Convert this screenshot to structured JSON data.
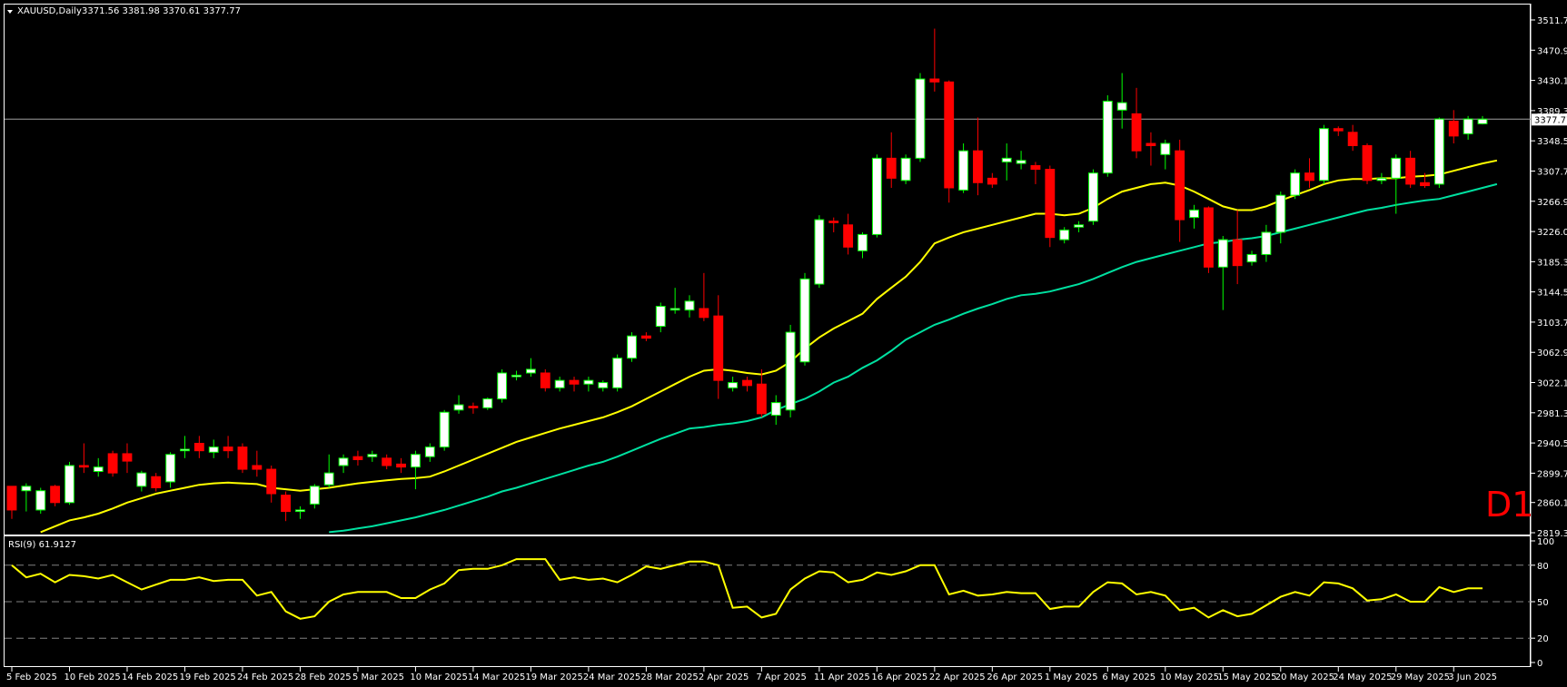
{
  "header": {
    "symbol_label": "XAUUSD,Daily",
    "ohlc_label": "3371.56 3381.98 3370.61 3377.77"
  },
  "timeframe_label": "D1",
  "current_price_label": "3377.77",
  "rsi": {
    "label": "RSI(9) 61.9127",
    "levels": [
      80,
      50,
      20
    ],
    "axis_labels": [
      "100",
      "80",
      "50",
      "20",
      "0"
    ]
  },
  "colors": {
    "background": "#000000",
    "bull_fill": "#ffffff",
    "bear_fill": "#ff0000",
    "wick_bull": "#00ff00",
    "wick_bear": "#ff0000",
    "ma_fast": "#ffff00",
    "ma_slow": "#00e0a0",
    "rsi_line": "#ffff00",
    "axis": "#ffffff",
    "grid": "#808080"
  },
  "chart_data": {
    "type": "candlestick",
    "title": "XAUUSD,Daily",
    "ylim": [
      2819.3,
      3511.7
    ],
    "y_ticks": [
      "3511.70",
      "3470.90",
      "3430.10",
      "3389.30",
      "3348.50",
      "3307.70",
      "3266.90",
      "3226.00",
      "3185.30",
      "3144.50",
      "3103.70",
      "3062.90",
      "3022.10",
      "2981.30",
      "2940.50",
      "2899.70",
      "2860.10",
      "2819.30"
    ],
    "x_labels": [
      "5 Feb 2025",
      "10 Feb 2025",
      "14 Feb 2025",
      "19 Feb 2025",
      "24 Feb 2025",
      "28 Feb 2025",
      "5 Mar 2025",
      "10 Mar 2025",
      "14 Mar 2025",
      "19 Mar 2025",
      "24 Mar 2025",
      "28 Mar 2025",
      "2 Apr 2025",
      "7 Apr 2025",
      "11 Apr 2025",
      "16 Apr 2025",
      "22 Apr 2025",
      "26 Apr 2025",
      "1 May 2025",
      "6 May 2025",
      "10 May 2025",
      "15 May 2025",
      "20 May 2025",
      "24 May 2025",
      "29 May 2025",
      "3 Jun 2025"
    ],
    "candles": [
      [
        2882,
        2850,
        2838,
        2882
      ],
      [
        2876,
        2882,
        2848,
        2886
      ],
      [
        2850,
        2876,
        2845,
        2880
      ],
      [
        2882,
        2860,
        2855,
        2884
      ],
      [
        2860,
        2910,
        2857,
        2915
      ],
      [
        2910,
        2908,
        2900,
        2940
      ],
      [
        2902,
        2908,
        2895,
        2920
      ],
      [
        2926,
        2900,
        2895,
        2930
      ],
      [
        2926,
        2916,
        2900,
        2940
      ],
      [
        2882,
        2900,
        2875,
        2903
      ],
      [
        2895,
        2880,
        2875,
        2900
      ],
      [
        2888,
        2925,
        2880,
        2928
      ],
      [
        2930,
        2932,
        2920,
        2950
      ],
      [
        2940,
        2930,
        2920,
        2950
      ],
      [
        2928,
        2935,
        2920,
        2945
      ],
      [
        2935,
        2930,
        2920,
        2950
      ],
      [
        2935,
        2905,
        2900,
        2940
      ],
      [
        2910,
        2905,
        2895,
        2930
      ],
      [
        2905,
        2872,
        2860,
        2910
      ],
      [
        2870,
        2848,
        2835,
        2875
      ],
      [
        2848,
        2850,
        2838,
        2855
      ],
      [
        2858,
        2882,
        2852,
        2885
      ],
      [
        2884,
        2900,
        2880,
        2925
      ],
      [
        2910,
        2920,
        2900,
        2925
      ],
      [
        2922,
        2918,
        2910,
        2930
      ],
      [
        2922,
        2925,
        2915,
        2930
      ],
      [
        2920,
        2910,
        2905,
        2925
      ],
      [
        2912,
        2908,
        2900,
        2920
      ],
      [
        2908,
        2925,
        2878,
        2930
      ],
      [
        2922,
        2935,
        2915,
        2940
      ],
      [
        2935,
        2982,
        2930,
        2985
      ],
      [
        2985,
        2992,
        2980,
        3005
      ],
      [
        2990,
        2988,
        2980,
        2995
      ],
      [
        2988,
        3000,
        2985,
        3002
      ],
      [
        3000,
        3035,
        2995,
        3040
      ],
      [
        3030,
        3032,
        3025,
        3038
      ],
      [
        3035,
        3040,
        3030,
        3055
      ],
      [
        3035,
        3015,
        3010,
        3040
      ],
      [
        3015,
        3025,
        3010,
        3030
      ],
      [
        3025,
        3020,
        3010,
        3030
      ],
      [
        3020,
        3025,
        3010,
        3030
      ],
      [
        3015,
        3022,
        3010,
        3025
      ],
      [
        3015,
        3055,
        3010,
        3060
      ],
      [
        3055,
        3085,
        3050,
        3090
      ],
      [
        3085,
        3082,
        3078,
        3090
      ],
      [
        3098,
        3125,
        3090,
        3130
      ],
      [
        3120,
        3122,
        3115,
        3150
      ],
      [
        3120,
        3132,
        3110,
        3140
      ],
      [
        3122,
        3110,
        3105,
        3170
      ],
      [
        3112,
        3025,
        3000,
        3140
      ],
      [
        3015,
        3022,
        3010,
        3030
      ],
      [
        3025,
        3018,
        3010,
        3030
      ],
      [
        3020,
        2980,
        2975,
        3040
      ],
      [
        2978,
        2995,
        2965,
        3005
      ],
      [
        2985,
        3090,
        2975,
        3100
      ],
      [
        3050,
        3162,
        3045,
        3170
      ],
      [
        3155,
        3242,
        3150,
        3248
      ],
      [
        3240,
        3238,
        3225,
        3245
      ],
      [
        3235,
        3205,
        3195,
        3250
      ],
      [
        3200,
        3222,
        3190,
        3225
      ],
      [
        3222,
        3325,
        3218,
        3330
      ],
      [
        3325,
        3298,
        3285,
        3360
      ],
      [
        3295,
        3325,
        3290,
        3330
      ],
      [
        3325,
        3432,
        3320,
        3440
      ],
      [
        3432,
        3428,
        3415,
        3500
      ],
      [
        3428,
        3285,
        3265,
        3430
      ],
      [
        3282,
        3335,
        3278,
        3345
      ],
      [
        3335,
        3292,
        3275,
        3380
      ],
      [
        3298,
        3290,
        3285,
        3305
      ],
      [
        3320,
        3325,
        3295,
        3345
      ],
      [
        3318,
        3322,
        3310,
        3335
      ],
      [
        3315,
        3310,
        3290,
        3320
      ],
      [
        3310,
        3218,
        3205,
        3315
      ],
      [
        3215,
        3228,
        3210,
        3232
      ],
      [
        3232,
        3235,
        3225,
        3240
      ],
      [
        3240,
        3305,
        3235,
        3310
      ],
      [
        3305,
        3402,
        3300,
        3410
      ],
      [
        3390,
        3400,
        3365,
        3440
      ],
      [
        3385,
        3335,
        3325,
        3420
      ],
      [
        3345,
        3342,
        3315,
        3360
      ],
      [
        3330,
        3345,
        3310,
        3350
      ],
      [
        3335,
        3242,
        3212,
        3350
      ],
      [
        3245,
        3255,
        3230,
        3262
      ],
      [
        3258,
        3178,
        3170,
        3260
      ],
      [
        3178,
        3215,
        3120,
        3220
      ],
      [
        3215,
        3180,
        3155,
        3255
      ],
      [
        3185,
        3195,
        3180,
        3200
      ],
      [
        3195,
        3225,
        3185,
        3235
      ],
      [
        3225,
        3275,
        3210,
        3280
      ],
      [
        3275,
        3305,
        3270,
        3310
      ],
      [
        3305,
        3295,
        3285,
        3325
      ],
      [
        3295,
        3365,
        3290,
        3370
      ],
      [
        3365,
        3362,
        3355,
        3368
      ],
      [
        3360,
        3342,
        3335,
        3370
      ],
      [
        3342,
        3295,
        3290,
        3345
      ],
      [
        3295,
        3298,
        3290,
        3305
      ],
      [
        3298,
        3325,
        3250,
        3330
      ],
      [
        3325,
        3290,
        3285,
        3335
      ],
      [
        3292,
        3288,
        3285,
        3305
      ],
      [
        3290,
        3378,
        3285,
        3380
      ],
      [
        3375,
        3355,
        3345,
        3390
      ],
      [
        3358,
        3378,
        3350,
        3382
      ],
      [
        3371.56,
        3377.77,
        3370.61,
        3381.98
      ]
    ],
    "ma_fast": [
      2805,
      2812,
      2820,
      2828,
      2836,
      2840,
      2845,
      2852,
      2860,
      2866,
      2872,
      2876,
      2880,
      2884,
      2886,
      2887,
      2886,
      2885,
      2880,
      2878,
      2876,
      2878,
      2880,
      2883,
      2886,
      2888,
      2890,
      2892,
      2893,
      2895,
      2902,
      2910,
      2918,
      2926,
      2934,
      2942,
      2948,
      2954,
      2960,
      2965,
      2970,
      2975,
      2982,
      2990,
      3000,
      3010,
      3020,
      3030,
      3038,
      3040,
      3038,
      3035,
      3033,
      3038,
      3050,
      3068,
      3083,
      3095,
      3105,
      3115,
      3135,
      3150,
      3165,
      3185,
      3210,
      3218,
      3225,
      3230,
      3235,
      3240,
      3245,
      3250,
      3250,
      3248,
      3250,
      3258,
      3270,
      3280,
      3285,
      3290,
      3292,
      3288,
      3280,
      3270,
      3260,
      3255,
      3255,
      3260,
      3268,
      3275,
      3282,
      3290,
      3295,
      3297,
      3297,
      3298,
      3298,
      3300,
      3301,
      3303,
      3308,
      3313,
      3318,
      3322
    ],
    "ma_slow": [
      2760,
      2763,
      2766,
      2769,
      2772,
      2775,
      2778,
      2781,
      2784,
      2787,
      2790,
      2793,
      2796,
      2799,
      2802,
      2805,
      2808,
      2810,
      2812,
      2814,
      2815,
      2818,
      2820,
      2822,
      2825,
      2828,
      2832,
      2836,
      2840,
      2845,
      2850,
      2856,
      2862,
      2868,
      2875,
      2880,
      2886,
      2892,
      2898,
      2904,
      2910,
      2915,
      2922,
      2930,
      2938,
      2946,
      2953,
      2960,
      2962,
      2965,
      2967,
      2970,
      2975,
      2985,
      2993,
      3000,
      3010,
      3022,
      3030,
      3042,
      3052,
      3065,
      3080,
      3090,
      3100,
      3107,
      3115,
      3122,
      3128,
      3135,
      3140,
      3142,
      3145,
      3150,
      3155,
      3162,
      3170,
      3178,
      3185,
      3190,
      3195,
      3200,
      3205,
      3210,
      3212,
      3215,
      3217,
      3220,
      3225,
      3230,
      3235,
      3240,
      3245,
      3250,
      3255,
      3258,
      3262,
      3265,
      3268,
      3270,
      3275,
      3280,
      3285,
      3290
    ],
    "rsi": [
      80,
      70,
      73,
      66,
      72,
      71,
      69,
      72,
      66,
      60,
      64,
      68,
      68,
      70,
      67,
      68,
      68,
      55,
      58,
      42,
      36,
      38,
      50,
      56,
      58,
      58,
      58,
      53,
      53,
      60,
      65,
      76,
      77,
      77,
      80,
      85,
      85,
      85,
      68,
      70,
      68,
      69,
      66,
      72,
      79,
      77,
      80,
      83,
      83,
      80,
      45,
      46,
      37,
      40,
      60,
      69,
      75,
      74,
      66,
      68,
      74,
      72,
      75,
      80,
      80,
      56,
      59,
      55,
      56,
      58,
      57,
      57,
      44,
      46,
      46,
      58,
      66,
      65,
      56,
      58,
      55,
      43,
      45,
      37,
      43,
      38,
      40,
      47,
      54,
      58,
      55,
      66,
      65,
      61,
      51,
      52,
      56,
      50,
      50,
      62,
      58,
      61,
      61
    ]
  }
}
